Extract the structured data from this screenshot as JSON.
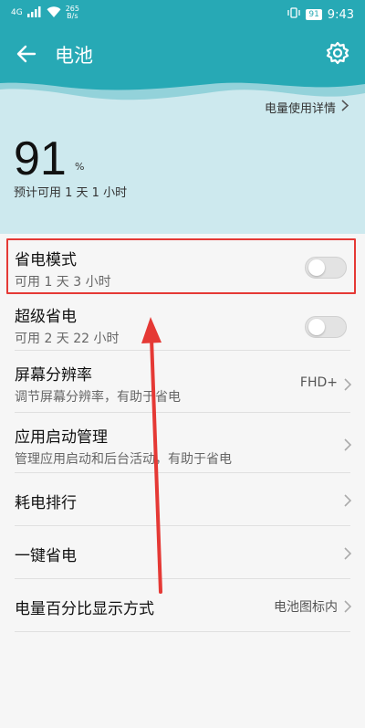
{
  "status_bar": {
    "signal": "4G",
    "net_speed_value": "265",
    "net_speed_unit": "B/s",
    "battery_level": "91",
    "time": "9:43"
  },
  "app_bar": {
    "title": "电池"
  },
  "battery": {
    "usage_details_link": "电量使用详情",
    "level": "91",
    "percent_sign": "%",
    "estimate": "预计可用 1 天 1 小时"
  },
  "settings": [
    {
      "label": "省电模式",
      "sub": "可用 1 天 3 小时",
      "control": "toggle",
      "on": false
    },
    {
      "label": "超级省电",
      "sub": "可用 2 天 22 小时",
      "control": "toggle",
      "on": false
    },
    {
      "label": "屏幕分辨率",
      "sub": "调节屏幕分辨率，有助于省电",
      "value": "FHD+",
      "control": "chevron"
    },
    {
      "label": "应用启动管理",
      "sub": "管理应用启动和后台活动，有助于省电",
      "control": "chevron"
    },
    {
      "label": "耗电排行",
      "control": "chevron"
    },
    {
      "label": "一键省电",
      "control": "chevron"
    },
    {
      "label": "电量百分比显示方式",
      "value": "电池图标内",
      "control": "chevron"
    }
  ],
  "colors": {
    "header": "#27a9b5",
    "hero_bg": "#cde9ee",
    "annotation": "#e53935"
  },
  "annotation": {
    "highlight_target": "省电模式",
    "arrow_color": "#e53935"
  }
}
